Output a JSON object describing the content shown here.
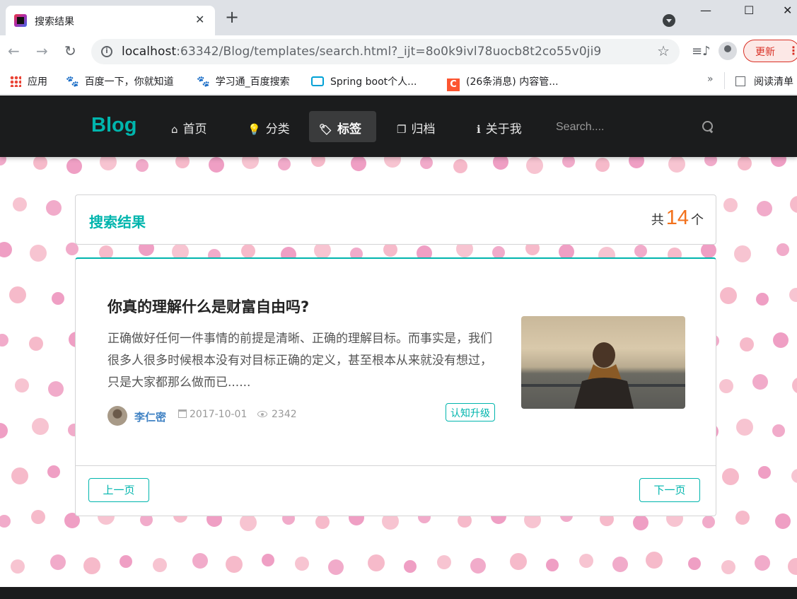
{
  "browser": {
    "tab_title": "搜索结果",
    "tab_close": "✕",
    "new_tab": "+",
    "url_host": "localhost",
    "url_rest": ":63342/Blog/templates/search.html?_ijt=8o0k9ivl78uocb8t2co55v0ji9",
    "update_label": "更新",
    "bookmarks": [
      {
        "label": "应用",
        "icon": "apps-grid-icon"
      },
      {
        "label": "百度一下，你就知道",
        "icon": "baidu-paw-icon"
      },
      {
        "label": "学习通_百度搜索",
        "icon": "baidu-paw-icon"
      },
      {
        "label": "Spring boot个人...",
        "icon": "bilibili-tv-icon"
      },
      {
        "label": "(26条消息) 内容管...",
        "icon": "csdn-c-icon"
      }
    ],
    "bookmarks_more": "»",
    "reading_list": "阅读清单"
  },
  "site": {
    "brand": "Blog",
    "nav": [
      {
        "label": "首页",
        "icon": "home-icon",
        "active": false
      },
      {
        "label": "分类",
        "icon": "lightbulb-icon",
        "active": false
      },
      {
        "label": "标签",
        "icon": "tags-icon",
        "active": true
      },
      {
        "label": "归档",
        "icon": "clone-icon",
        "active": false
      },
      {
        "label": "关于我",
        "icon": "info-icon",
        "active": false
      }
    ],
    "search_placeholder": "Search...."
  },
  "results_header": {
    "title": "搜索结果",
    "count_prefix": "共",
    "count": "14",
    "count_suffix": "个"
  },
  "post": {
    "title": "你真的理解什么是财富自由吗?",
    "excerpt": "正确做好任何一件事情的前提是清晰、正确的理解目标。而事实是，我们很多人很多时候根本没有对目标正确的定义，甚至根本从来就没有想过，只是大家都那么做而已......",
    "author": "李仁密",
    "date": "2017-10-01",
    "views": "2342",
    "tag": "认知升级"
  },
  "pager": {
    "prev": "上一页",
    "next": "下一页"
  },
  "colors": {
    "accent": "#00b5ad",
    "count": "#f2711c",
    "nav_bg": "#1b1c1d",
    "author": "#4183c4"
  }
}
